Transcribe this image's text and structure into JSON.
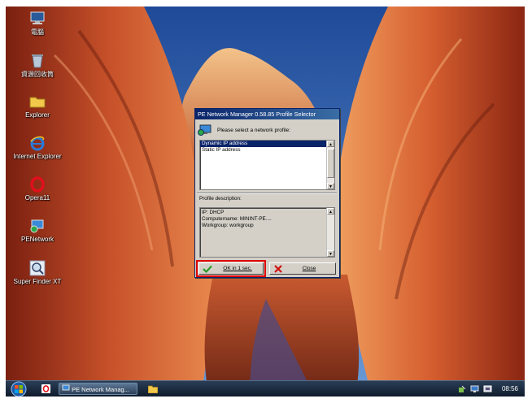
{
  "desktop": {
    "icons": [
      {
        "label": "電腦",
        "icon": "computer-icon"
      },
      {
        "label": "資源回收筒",
        "icon": "recycle-bin-icon"
      },
      {
        "label": "Explorer",
        "icon": "folder-icon"
      },
      {
        "label": "Internet Explorer",
        "icon": "internet-explorer-icon"
      },
      {
        "label": "Opera11",
        "icon": "opera-icon"
      },
      {
        "label": "PENetwork",
        "icon": "network-icon"
      },
      {
        "label": "Super Finder XT",
        "icon": "magnifier-icon"
      }
    ]
  },
  "dialog": {
    "title": "PE Network Manager 0.58.85 Profile Selector",
    "prompt": "Please select a network profile:",
    "profiles": [
      "Dynamic IP address",
      "Static IP address"
    ],
    "selected_index": 0,
    "description_label": "Profile description:",
    "description_lines": [
      "IP: DHCP",
      "Computername: MININT-PE....",
      "Workgroup: workgroup"
    ],
    "ok_label": "OK in 1 sec.",
    "close_label": "Close",
    "colors": {
      "title_start": "#0a246a",
      "title_end": "#3a6ea5",
      "highlight": "#e00000"
    }
  },
  "taskbar": {
    "start_icon": "windows-orb-icon",
    "task_label": "PE Network Manag...",
    "clock": "08:56"
  }
}
